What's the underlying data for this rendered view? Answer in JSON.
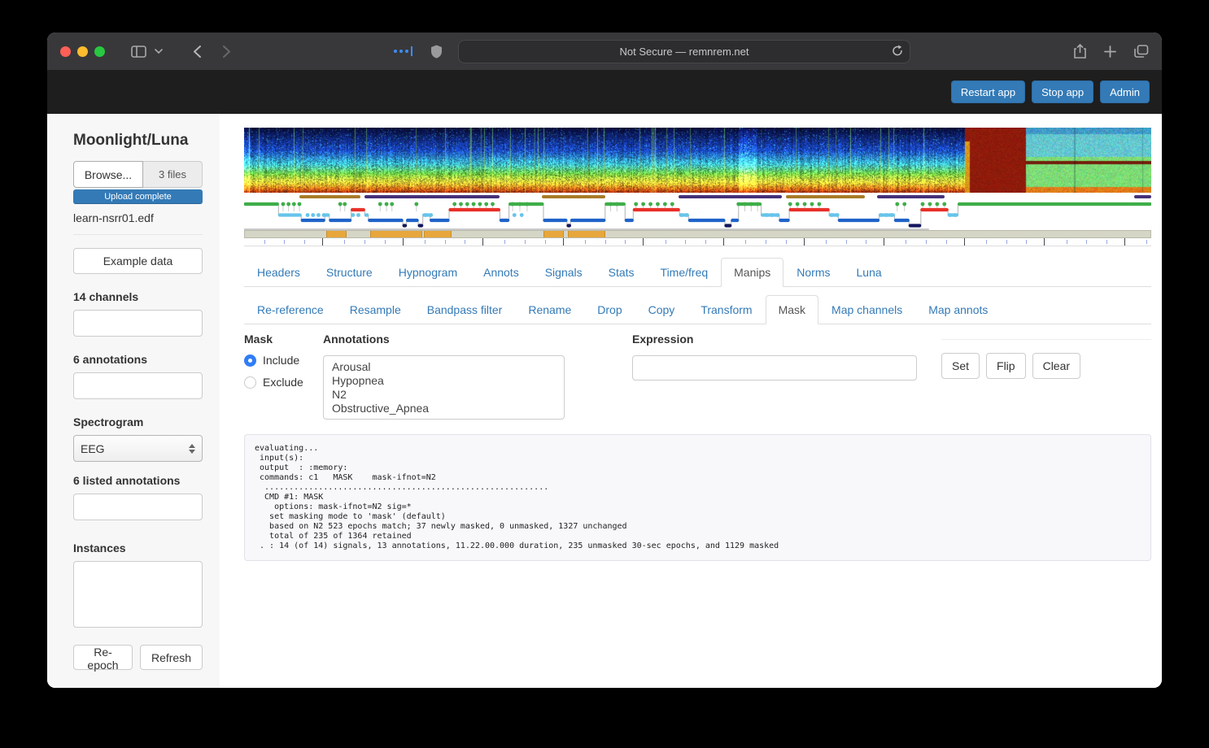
{
  "browser": {
    "url_text": "Not Secure — remnrem.net",
    "traffic_lights": [
      "#ff5f57",
      "#febc2e",
      "#28c840"
    ]
  },
  "app_header": {
    "buttons": [
      "Restart app",
      "Stop app",
      "Admin"
    ],
    "button_color": "#337ab7"
  },
  "sidebar": {
    "title": "Moonlight/Luna",
    "browse_label": "Browse...",
    "files_badge": "3 files",
    "upload_status": "Upload complete",
    "filename": "learn-nsrr01.edf",
    "example_button": "Example data",
    "channels_label": "14 channels",
    "annotations_label": "6 annotations",
    "spectrogram_label": "Spectrogram",
    "spectrogram_select_value": "EEG",
    "listed_annotations_label": "6 listed annotations",
    "instances_label": "Instances",
    "reepoch_button": "Re-epoch",
    "refresh_button": "Refresh"
  },
  "tabs": {
    "items": [
      "Headers",
      "Structure",
      "Hypnogram",
      "Annots",
      "Signals",
      "Stats",
      "Time/freq",
      "Manips",
      "Norms",
      "Luna"
    ],
    "active": "Manips"
  },
  "subtabs": {
    "items": [
      "Re-reference",
      "Resample",
      "Bandpass filter",
      "Rename",
      "Drop",
      "Copy",
      "Transform",
      "Mask",
      "Map channels",
      "Map annots"
    ],
    "active": "Mask"
  },
  "mask_panel": {
    "heading": "Mask",
    "radio_include": "Include",
    "radio_exclude": "Exclude",
    "include_selected": true,
    "annotations_label": "Annotations",
    "annotation_options": [
      "Arousal",
      "Hypopnea",
      "N2",
      "Obstructive_Apnea"
    ],
    "expression_label": "Expression",
    "expression_value": "",
    "action_buttons": [
      "Set",
      "Flip",
      "Clear"
    ]
  },
  "console": {
    "lines": [
      "evaluating...",
      " input(s): ",
      " output  : :memory:",
      " commands: c1   MASK    mask-ifnot=N2",
      "  ..........................................................",
      "  CMD #1: MASK",
      "    options: mask-ifnot=N2 sig=*",
      "   set masking mode to 'mask' (default)",
      "   based on N2 523 epochs match; 37 newly masked, 0 unmasked, 1327 unchanged",
      "   total of 235 of 1364 retained",
      " . : 14 (of 14) signals, 13 annotations, 11.22.00.000 duration, 235 unmasked 30-sec epochs, and 1129 masked"
    ]
  },
  "viz": {
    "spectrogram": {
      "block_start": 0.794,
      "block_end": 0.861,
      "bright_regions": [
        [
          0.0,
          0.007
        ],
        [
          0.545,
          0.565
        ]
      ]
    },
    "annotation_spans": {
      "colors": {
        "brown": "#a87b28",
        "purple": "#46317a"
      },
      "spans": [
        {
          "s": 0.061,
          "e": 0.128,
          "c": "brown"
        },
        {
          "s": 0.133,
          "e": 0.282,
          "c": "purple"
        },
        {
          "s": 0.328,
          "e": 0.398,
          "c": "brown"
        },
        {
          "s": 0.479,
          "e": 0.593,
          "c": "purple"
        },
        {
          "s": 0.597,
          "e": 0.684,
          "c": "brown"
        },
        {
          "s": 0.698,
          "e": 0.772,
          "c": "purple"
        },
        {
          "s": 0.981,
          "e": 1.0,
          "c": "purple"
        }
      ]
    },
    "hypnogram": {
      "stage_colors": {
        "W": "#3fae49",
        "R": "#e8312a",
        "N1": "#67c4ea",
        "N2": "#1f63c9",
        "N3": "#14175e"
      },
      "stage_levels": {
        "W": 6,
        "R": 13,
        "N1": 19.5,
        "N2": 26,
        "N3": 32.5
      },
      "baseline_end": 0.755,
      "segments": [
        [
          0.0,
          0.038,
          "W"
        ],
        [
          0.038,
          0.063,
          "N1"
        ],
        [
          0.063,
          0.089,
          "N2"
        ],
        [
          0.089,
          0.094,
          "N1"
        ],
        [
          0.094,
          0.118,
          "N2"
        ],
        [
          0.118,
          0.133,
          "R"
        ],
        [
          0.133,
          0.137,
          "N1"
        ],
        [
          0.137,
          0.175,
          "N2"
        ],
        [
          0.175,
          0.179,
          "N3"
        ],
        [
          0.179,
          0.192,
          "N2"
        ],
        [
          0.192,
          0.197,
          "N3"
        ],
        [
          0.197,
          0.205,
          "N1"
        ],
        [
          0.205,
          0.226,
          "N2"
        ],
        [
          0.226,
          0.282,
          "R"
        ],
        [
          0.282,
          0.292,
          "N2"
        ],
        [
          0.292,
          0.33,
          "W"
        ],
        [
          0.33,
          0.356,
          "N2"
        ],
        [
          0.356,
          0.36,
          "N3"
        ],
        [
          0.36,
          0.398,
          "N2"
        ],
        [
          0.398,
          0.42,
          "W"
        ],
        [
          0.42,
          0.429,
          "N2"
        ],
        [
          0.429,
          0.48,
          "R"
        ],
        [
          0.48,
          0.49,
          "N1"
        ],
        [
          0.49,
          0.53,
          "N2"
        ],
        [
          0.53,
          0.537,
          "N3"
        ],
        [
          0.537,
          0.545,
          "N2"
        ],
        [
          0.545,
          0.57,
          "W"
        ],
        [
          0.57,
          0.59,
          "N1"
        ],
        [
          0.59,
          0.601,
          "N2"
        ],
        [
          0.601,
          0.645,
          "R"
        ],
        [
          0.645,
          0.655,
          "N1"
        ],
        [
          0.655,
          0.7,
          "N2"
        ],
        [
          0.7,
          0.717,
          "N1"
        ],
        [
          0.717,
          0.733,
          "N2"
        ],
        [
          0.733,
          0.746,
          "N3"
        ],
        [
          0.746,
          0.776,
          "R"
        ],
        [
          0.776,
          0.787,
          "N1"
        ],
        [
          0.787,
          1.0,
          "W"
        ]
      ],
      "wake_dots": [
        0.043,
        0.049,
        0.055,
        0.061,
        0.106,
        0.111,
        0.15,
        0.157,
        0.163,
        0.19,
        0.232,
        0.239,
        0.246,
        0.253,
        0.26,
        0.267,
        0.274,
        0.296,
        0.304,
        0.312,
        0.404,
        0.411,
        0.432,
        0.44,
        0.448,
        0.456,
        0.464,
        0.472,
        0.545,
        0.552,
        0.559,
        0.566,
        0.602,
        0.61,
        0.618,
        0.626,
        0.634,
        0.72,
        0.728,
        0.748,
        0.756,
        0.764,
        0.772
      ],
      "n1_dots": [
        0.07,
        0.076,
        0.082,
        0.088,
        0.12,
        0.126,
        0.2,
        0.206,
        0.298,
        0.306,
        0.482,
        0.488,
        0.576,
        0.582,
        0.588,
        0.648,
        0.654,
        0.702,
        0.708,
        0.714,
        0.778,
        0.784
      ]
    },
    "mask_band": {
      "segments": [
        [
          0.09,
          0.112
        ],
        [
          0.138,
          0.196
        ],
        [
          0.198,
          0.228
        ],
        [
          0.33,
          0.352
        ],
        [
          0.357,
          0.398
        ]
      ]
    },
    "ruler": {
      "major_start": 96,
      "major_step": 98.6,
      "minor_step": 24.65
    }
  }
}
